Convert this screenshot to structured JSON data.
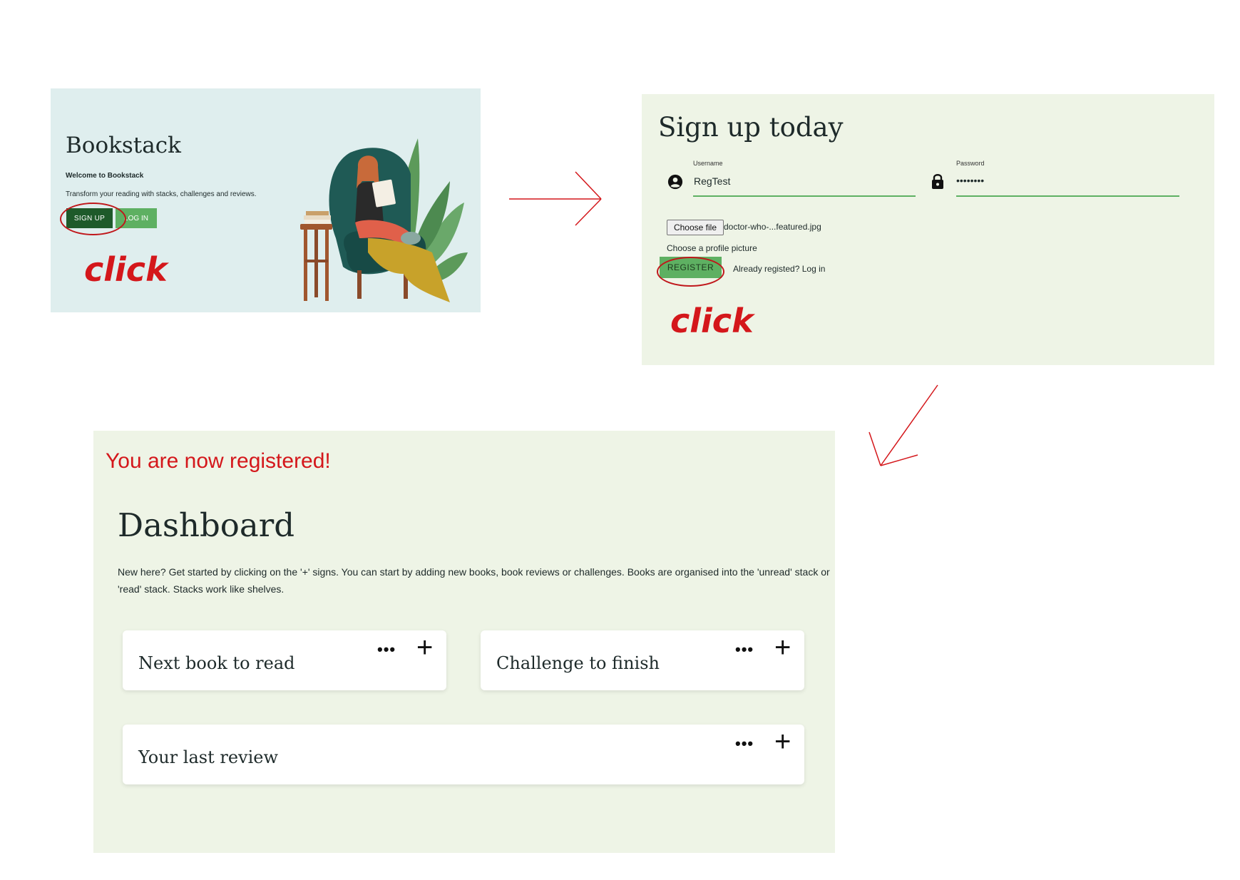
{
  "landing": {
    "title": "Bookstack",
    "welcome": "Welcome to Bookstack",
    "tagline": "Transform your reading with stacks, challenges and reviews.",
    "signup_label": "SIGN UP",
    "login_label": "LOG IN",
    "click_note": "click"
  },
  "signup": {
    "heading": "Sign up today",
    "username_label": "Username",
    "username_value": "RegTest",
    "password_label": "Password",
    "password_value": "••••••••",
    "choose_file_label": "Choose file",
    "file_name": "doctor-who-...featured.jpg",
    "profile_picture_label": "Choose a profile picture",
    "register_label": "REGISTER",
    "login_link": "Already registed? Log in",
    "click_note": "click"
  },
  "dashboard": {
    "registered_message": "You are now registered!",
    "title": "Dashboard",
    "intro": "New here? Get started by clicking on the '+' signs. You can start by adding new books, book reviews or challenges. Books are organised into the 'unread' stack or 'read' stack. Stacks work like shelves.",
    "cards": [
      {
        "title": "Next book to read",
        "dots": "•••",
        "plus": "+"
      },
      {
        "title": "Challenge to finish",
        "dots": "•••",
        "plus": "+"
      },
      {
        "title": "Your last review",
        "dots": "•••",
        "plus": "+"
      }
    ]
  },
  "colors": {
    "accent_red": "#d4171b",
    "dark_green": "#1e5a2a",
    "light_green": "#5eb062",
    "panel_green": "#eef4e6",
    "panel_teal": "#dfeeee"
  }
}
